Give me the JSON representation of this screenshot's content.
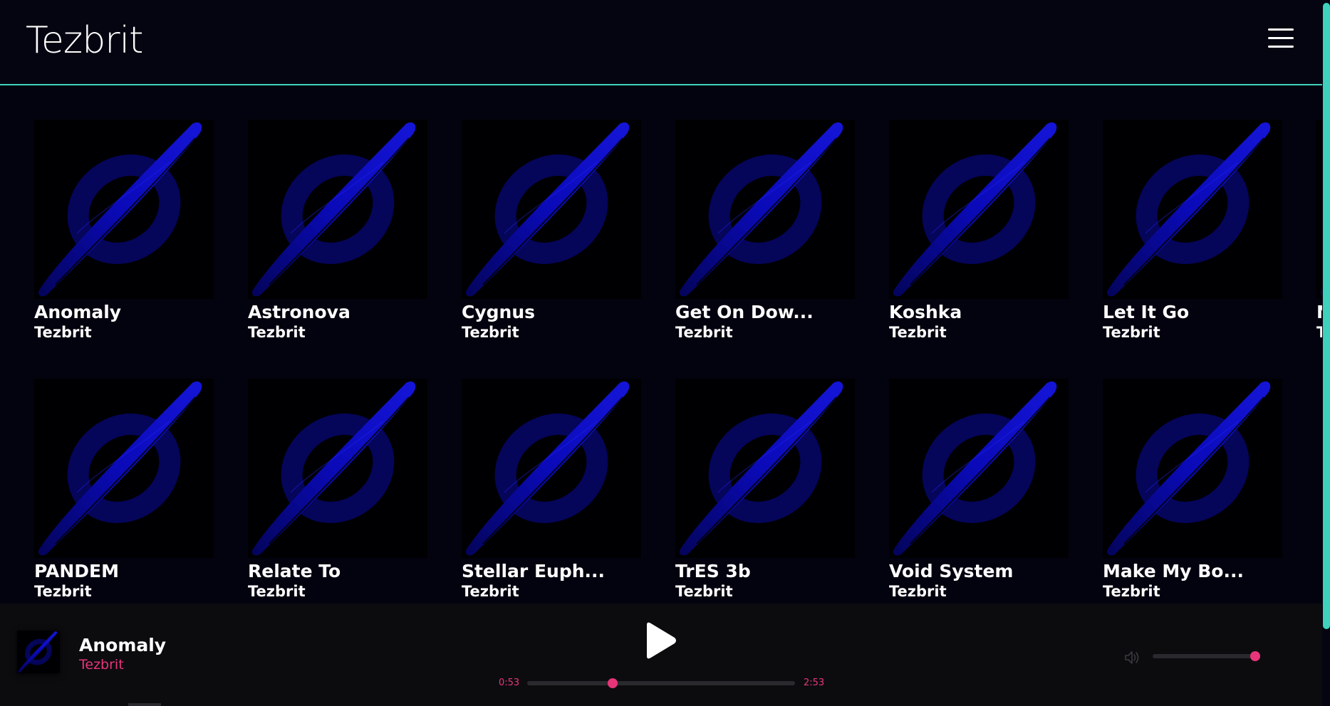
{
  "app": {
    "logo": "Tezbrit",
    "menu_icon": "hamburger-menu-icon"
  },
  "colors": {
    "accent": "#3fd1bc",
    "highlight": "#e8357a",
    "background": "#03030f",
    "cover_art": "#0a0ab0"
  },
  "tracks": [
    {
      "title": "Anomaly",
      "artist": "Tezbrit"
    },
    {
      "title": "Astronova",
      "artist": "Tezbrit"
    },
    {
      "title": "Cygnus",
      "artist": "Tezbrit"
    },
    {
      "title": "Get On Dow...",
      "artist": "Tezbrit"
    },
    {
      "title": "Koshka",
      "artist": "Tezbrit"
    },
    {
      "title": "Let It Go",
      "artist": "Tezbrit"
    },
    {
      "title": "N",
      "artist": "T"
    },
    {
      "title": "PANDEM",
      "artist": "Tezbrit"
    },
    {
      "title": "Relate To",
      "artist": "Tezbrit"
    },
    {
      "title": "Stellar Euph...",
      "artist": "Tezbrit"
    },
    {
      "title": "TrES 3b",
      "artist": "Tezbrit"
    },
    {
      "title": "Void System",
      "artist": "Tezbrit"
    },
    {
      "title": "Make My Bo...",
      "artist": "Tezbrit"
    }
  ],
  "player": {
    "title": "Anomaly",
    "artist": "Tezbrit",
    "current_time": "0:53",
    "total_time": "2:53",
    "progress": 0.32,
    "volume": 1.0,
    "play_icon": "play-icon",
    "volume_icon": "speaker-icon"
  }
}
